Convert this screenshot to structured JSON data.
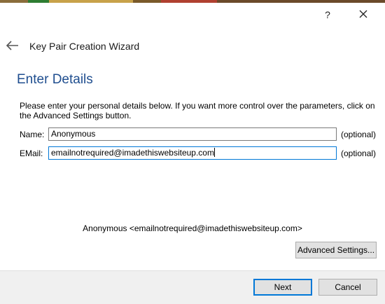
{
  "window": {
    "help_label": "?",
    "wizard_title": "Key Pair Creation Wizard"
  },
  "page": {
    "heading": "Enter Details",
    "description": "Please enter your personal details below. If you want more control over the parameters, click on the Advanced Settings button."
  },
  "form": {
    "name_label": "Name:",
    "name_value": "Anonymous",
    "email_label": "EMail:",
    "email_value": "emailnotrequired@imadethiswebsiteup.com",
    "optional_label": "(optional)"
  },
  "identity_preview": "Anonymous <emailnotrequired@imadethiswebsiteup.com>",
  "buttons": {
    "advanced": "Advanced Settings...",
    "next": "Next",
    "cancel": "Cancel"
  },
  "colors": {
    "heading": "#1f4e8f",
    "focus": "#0078d7",
    "button_face": "#e1e1e1",
    "footer": "#f0f0f0"
  },
  "icons": {
    "back": "arrow-left-icon",
    "close": "close-icon"
  }
}
